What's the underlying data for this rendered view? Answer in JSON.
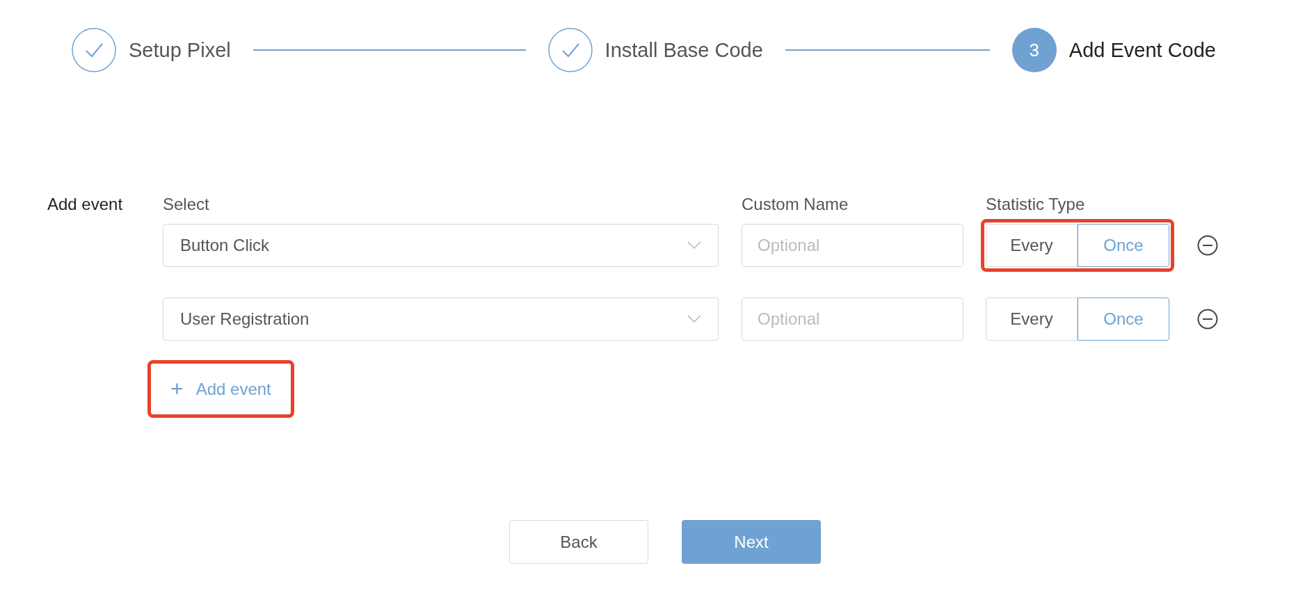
{
  "steps": [
    {
      "label": "Setup Pixel",
      "completed": true
    },
    {
      "label": "Install Base Code",
      "completed": true
    },
    {
      "number": "3",
      "label": "Add Event Code",
      "completed": false
    }
  ],
  "form": {
    "label": "Add event",
    "columns": [
      "Select",
      "Custom Name",
      "Statistic Type"
    ],
    "rows": [
      {
        "event": "Button Click",
        "custom_name_placeholder": "Optional",
        "highlighted": true,
        "statistic_options": [
          {
            "label": "Every",
            "selected": false
          },
          {
            "label": "Once",
            "selected": true
          }
        ]
      },
      {
        "event": "User Registration",
        "custom_name_placeholder": "Optional",
        "highlighted": false,
        "statistic_options": [
          {
            "label": "Every",
            "selected": false
          },
          {
            "label": "Once",
            "selected": true
          }
        ]
      }
    ],
    "add_event": {
      "icon": "+",
      "label": "Add event",
      "highlighted": true
    }
  },
  "buttons": [
    {
      "label": "Back",
      "kind": "secondary"
    },
    {
      "label": "Next",
      "kind": "primary"
    }
  ]
}
